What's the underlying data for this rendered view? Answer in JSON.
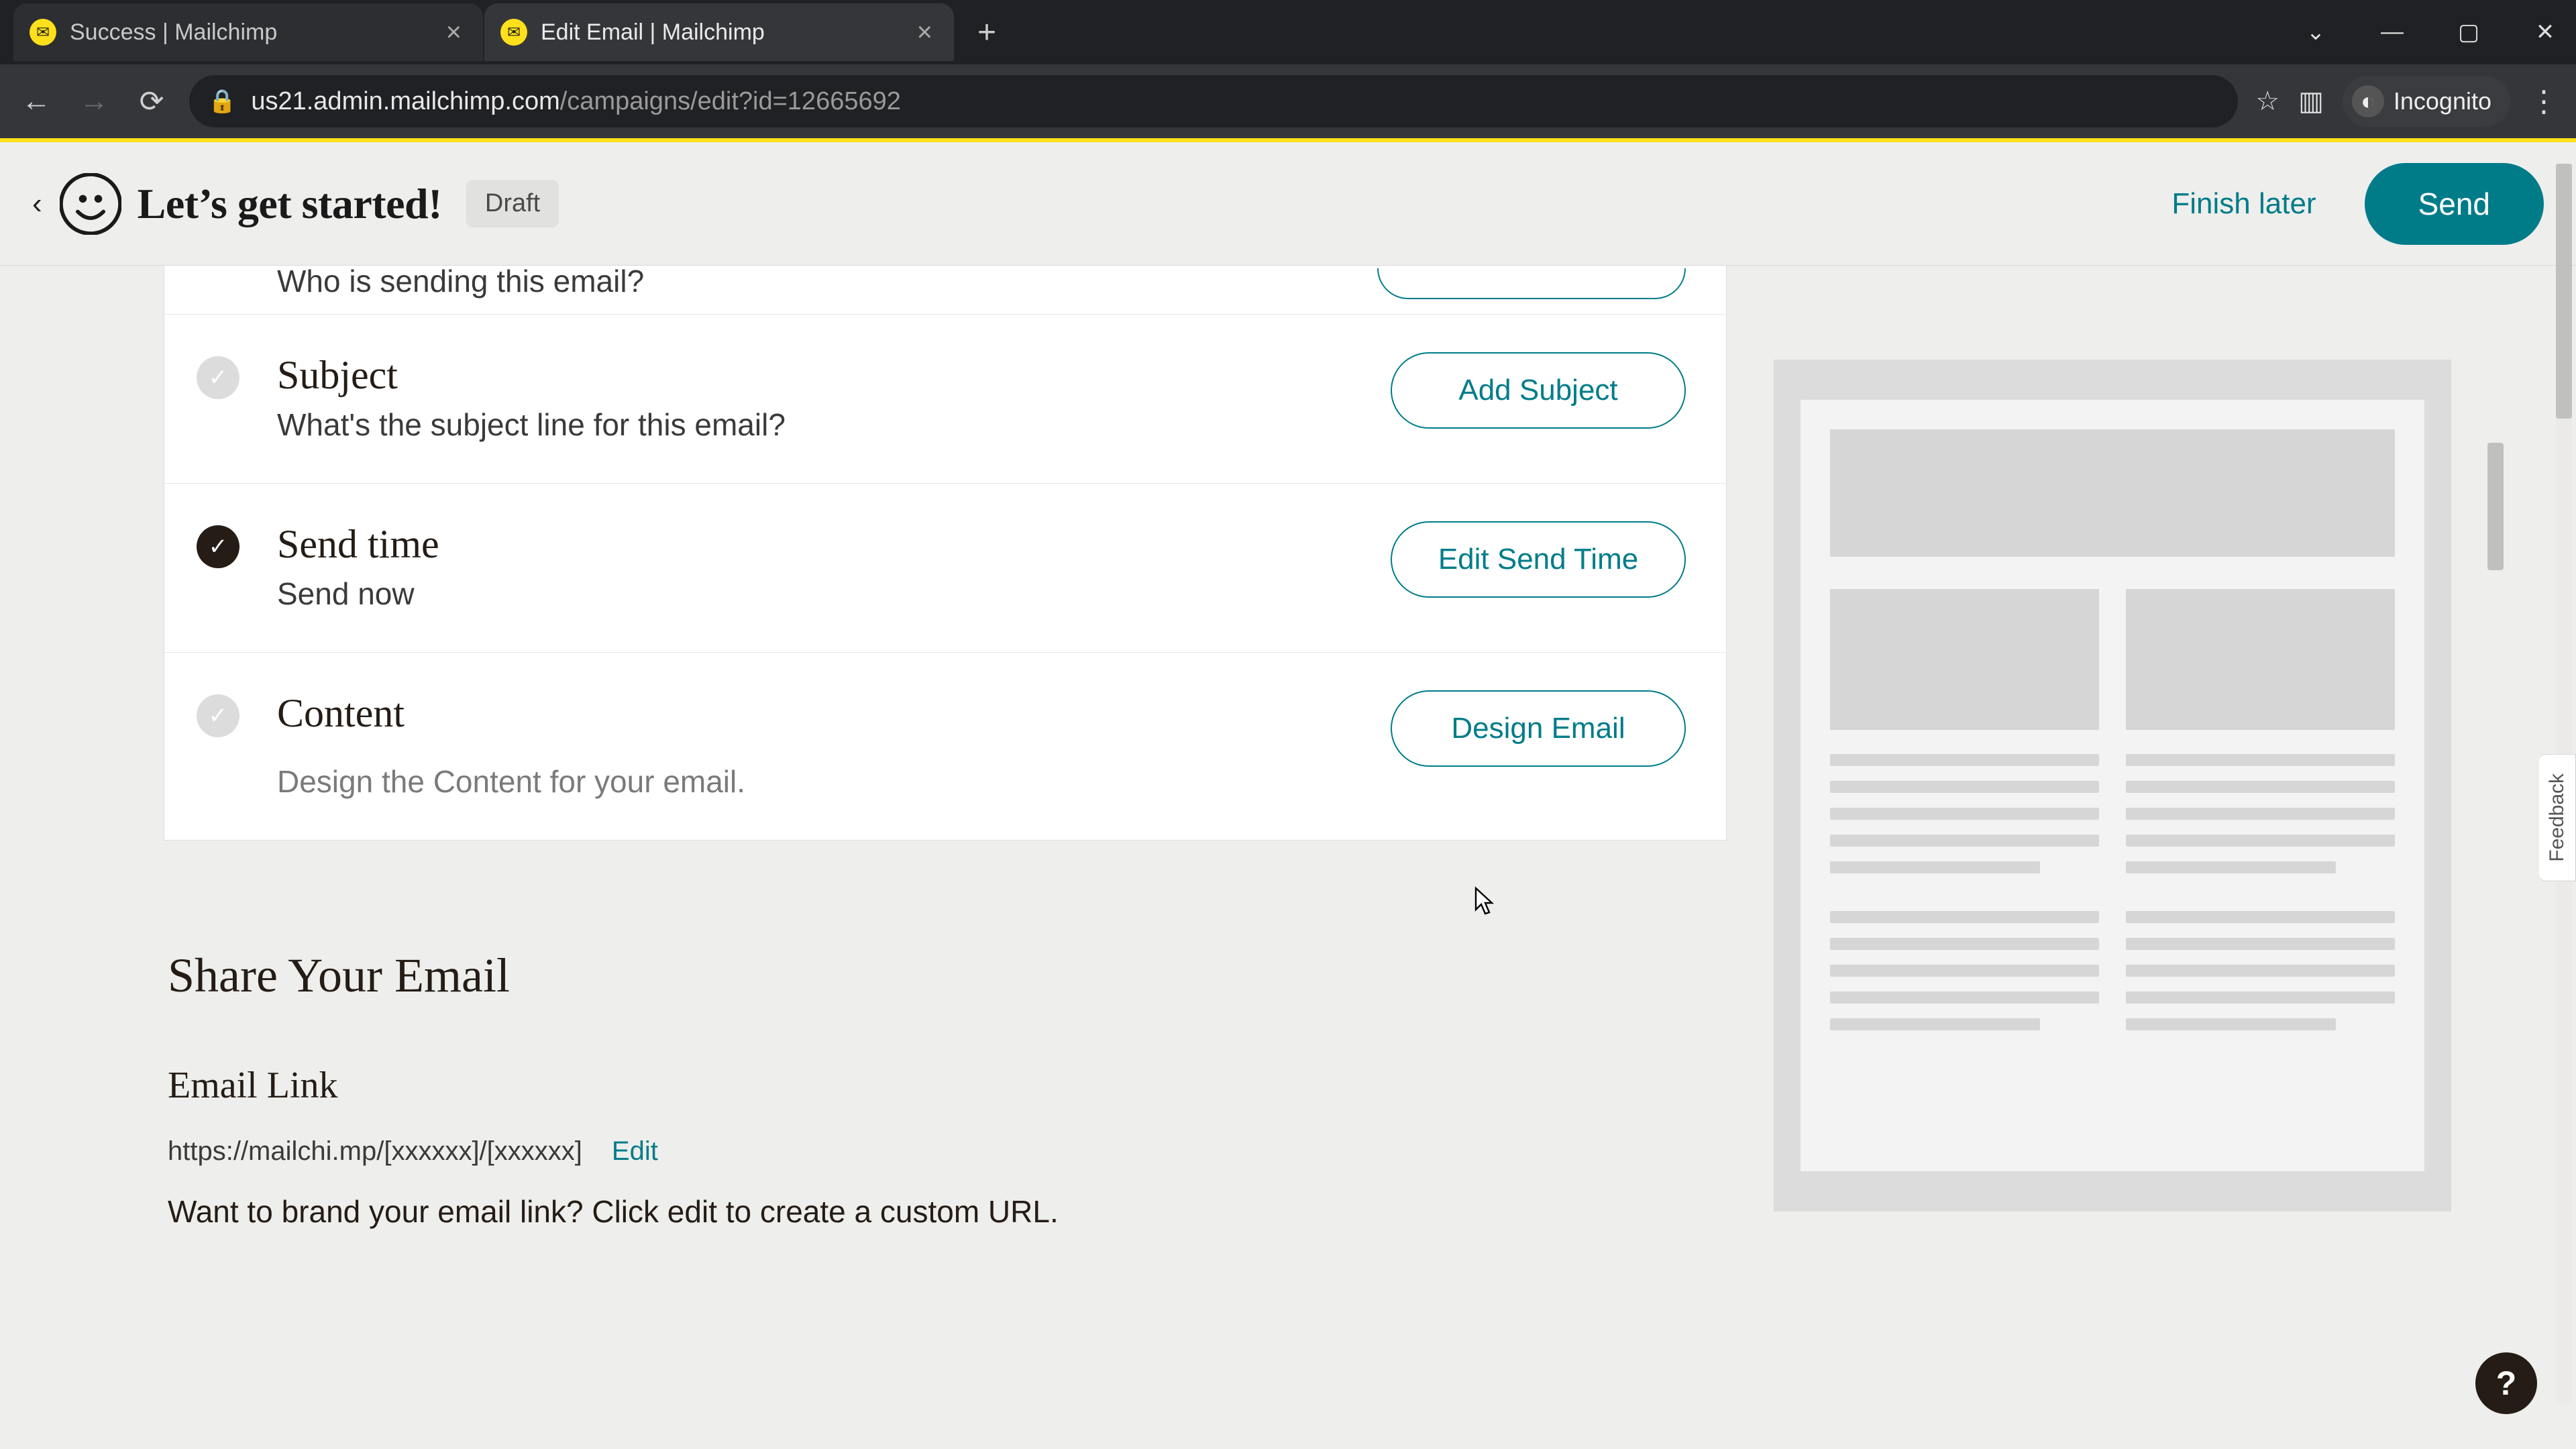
{
  "browser": {
    "tabs": [
      {
        "title": "Success | Mailchimp",
        "active": false
      },
      {
        "title": "Edit Email | Mailchimp",
        "active": true
      }
    ],
    "url_host": "us21.admin.mailchimp.com",
    "url_path": "/campaigns/edit?id=12665692",
    "incognito_label": "Incognito"
  },
  "header": {
    "title": "Let’s get started!",
    "badge": "Draft",
    "finish_later": "Finish later",
    "send": "Send"
  },
  "rows": {
    "from_sub": "Who is sending this email?",
    "subject": {
      "title": "Subject",
      "sub": "What's the subject line for this email?",
      "button": "Add Subject"
    },
    "send_time": {
      "title": "Send time",
      "sub": "Send now",
      "button": "Edit Send Time"
    },
    "content": {
      "title": "Content",
      "sub": "Design the Content for your email.",
      "button": "Design Email"
    }
  },
  "share": {
    "title": "Share Your Email",
    "subtitle": "Email Link",
    "url": "https://mailchi.mp/[xxxxxx]/[xxxxxx]",
    "edit": "Edit",
    "description": "Want to brand your email link? Click edit to create a custom URL."
  },
  "sidebar": {
    "feedback": "Feedback"
  },
  "help": "?"
}
